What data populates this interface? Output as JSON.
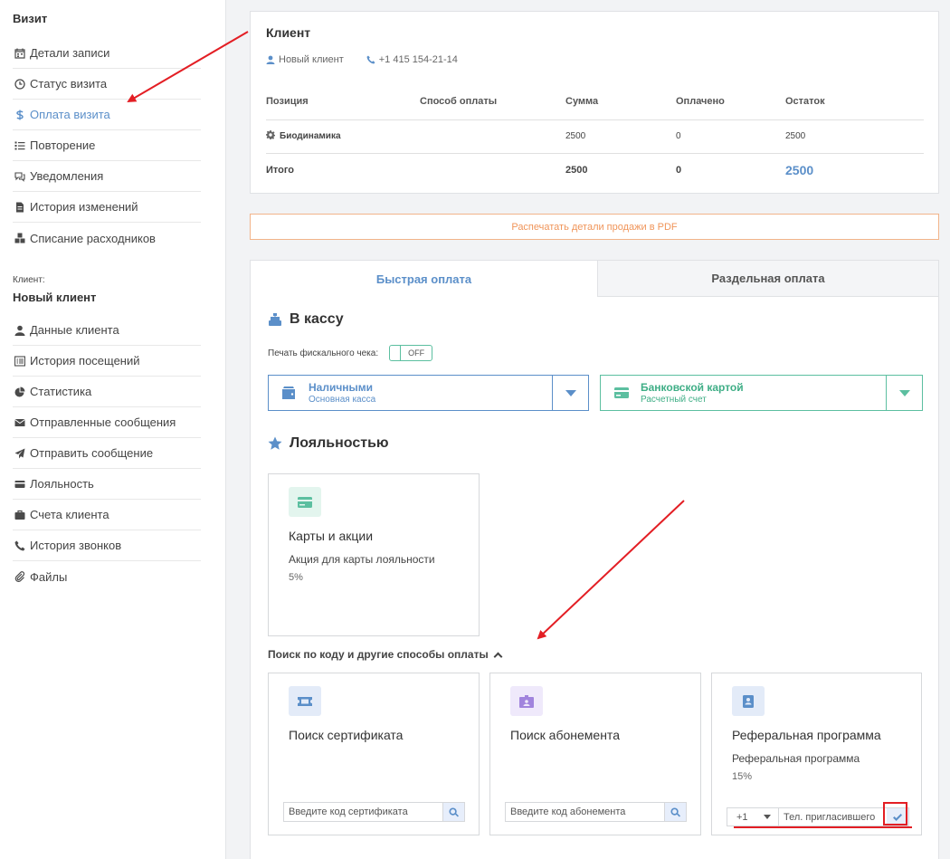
{
  "sidebar": {
    "visit_title": "Визит",
    "visit_items": [
      {
        "label": "Детали записи",
        "icon": "calendar-icon"
      },
      {
        "label": "Статус визита",
        "icon": "clock-icon"
      },
      {
        "label": "Оплата визита",
        "icon": "dollar-icon",
        "active": true
      },
      {
        "label": "Повторение",
        "icon": "list-icon"
      },
      {
        "label": "Уведомления",
        "icon": "comments-icon"
      },
      {
        "label": "История изменений",
        "icon": "file-icon"
      },
      {
        "label": "Списание расходников",
        "icon": "cubes-icon"
      }
    ],
    "client_label": "Клиент:",
    "client_name": "Новый клиент",
    "client_items": [
      {
        "label": "Данные клиента",
        "icon": "user-icon"
      },
      {
        "label": "История посещений",
        "icon": "list-alt-icon"
      },
      {
        "label": "Статистика",
        "icon": "pie-chart-icon"
      },
      {
        "label": "Отправленные сообщения",
        "icon": "envelope-icon"
      },
      {
        "label": "Отправить сообщение",
        "icon": "paper-plane-icon"
      },
      {
        "label": "Лояльность",
        "icon": "credit-card-icon"
      },
      {
        "label": "Счета клиента",
        "icon": "briefcase-icon"
      },
      {
        "label": "История звонков",
        "icon": "phone-icon"
      },
      {
        "label": "Файлы",
        "icon": "paperclip-icon"
      }
    ]
  },
  "client_card": {
    "title": "Клиент",
    "client_name": "Новый клиент",
    "phone": "+1 415 154-21-14",
    "columns": [
      "Позиция",
      "Способ оплаты",
      "Сумма",
      "Оплачено",
      "Остаток"
    ],
    "rows": [
      {
        "position": "Биодинамика",
        "method": "",
        "sum": "2500",
        "paid": "0",
        "remaining": "2500"
      }
    ],
    "total": {
      "label": "Итого",
      "sum": "2500",
      "paid": "0",
      "remaining": "2500"
    }
  },
  "pdf_button": "Распечатать детали продажи в PDF",
  "tabs": {
    "quick": "Быстрая оплата",
    "split": "Раздельная оплата"
  },
  "cashbox": {
    "title": "В кассу",
    "fiscal_label": "Печать фискального чека:",
    "toggle_state": "OFF",
    "cash": {
      "title": "Наличными",
      "subtitle": "Основная касса"
    },
    "card": {
      "title": "Банковской картой",
      "subtitle": "Расчетный счет"
    }
  },
  "loyalty": {
    "title": "Лояльностью",
    "tile": {
      "title": "Карты и акции",
      "subtitle": "Акция для карты лояльности",
      "percent": "5%"
    }
  },
  "other_methods": {
    "toggle_label": "Поиск по коду и другие способы оплаты",
    "certificate": {
      "title": "Поиск сертификата",
      "placeholder": "Введите код сертификата"
    },
    "subscription": {
      "title": "Поиск абонемента",
      "placeholder": "Введите код абонемента"
    },
    "referral": {
      "title": "Реферальная программа",
      "subtitle": "Реферальная программа",
      "percent": "15%",
      "phone_code": "+1",
      "phone_placeholder": "Тел. пригласившего"
    }
  },
  "colors": {
    "accent": "#5b8fc9",
    "green": "#3fae86",
    "orange": "#f0955a",
    "annotation_red": "#e31e24"
  }
}
